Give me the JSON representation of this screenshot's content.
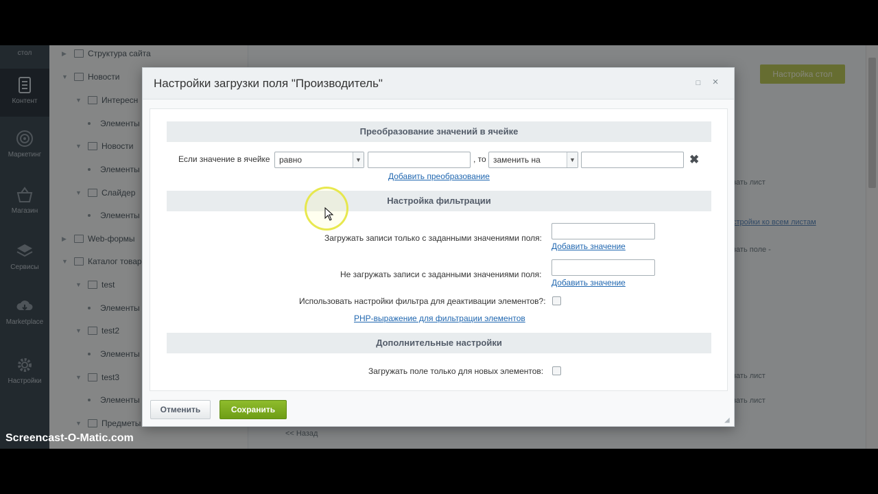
{
  "left_panel": {
    "items": [
      {
        "label": "стол",
        "icon": "desktop-icon"
      },
      {
        "label": "Контент",
        "icon": "document-icon"
      },
      {
        "label": "Маркетинг",
        "icon": "target-icon"
      },
      {
        "label": "Магазин",
        "icon": "basket-icon"
      },
      {
        "label": "Сервисы",
        "icon": "layers-icon"
      },
      {
        "label": "Marketplace",
        "icon": "cloud-download-icon"
      },
      {
        "label": "Настройки",
        "icon": "gear-icon"
      }
    ]
  },
  "tree": {
    "items": [
      "Структура сайта",
      "Новости",
      "Интересн",
      "Элементы",
      "Новости",
      "Элементы",
      "Слайдер",
      "Элементы",
      "Web-формы",
      "Каталог товар",
      "test",
      "Элементы",
      "test2",
      "Элементы",
      "test3",
      "Элементы",
      "Предметы"
    ]
  },
  "background": {
    "setting_button": "Настройка стол",
    "texts": [
      "зать лист",
      "стройки ко всем листам",
      "зать поле -",
      "зать лист",
      "зать лист",
      "<< Назад"
    ]
  },
  "modal": {
    "title": "Настройки загрузки поля \"Производитель\"",
    "maximize_icon": "□",
    "close_icon": "×",
    "sections": {
      "transform": {
        "heading": "Преобразование значений в ячейке",
        "if_label": "Если значение в ячейке",
        "condition_value": "равно",
        "to_label": ", то",
        "action_value": "заменить на",
        "source_value": "",
        "target_value": "",
        "delete_icon": "✖",
        "add_link": "Добавить преобразование"
      },
      "filter": {
        "heading": "Настройка фильтрации",
        "include_label": "Загружать записи только с заданными значениями поля:",
        "include_value": "",
        "include_add": "Добавить значение",
        "exclude_label": "Не загружать записи с заданными значениями поля:",
        "exclude_value": "",
        "exclude_add": "Добавить значение",
        "deactivate_label": "Использовать настройки фильтра для деактивации элементов?:",
        "deactivate_checked": false,
        "php_link": "PHP-выражение для фильтрации элементов"
      },
      "extra": {
        "heading": "Дополнительные настройки",
        "new_only_label": "Загружать поле только для новых элементов:",
        "new_only_checked": false
      }
    },
    "buttons": {
      "cancel": "Отменить",
      "save": "Сохранить"
    }
  },
  "watermark": "Screencast-O-Matic.com"
}
